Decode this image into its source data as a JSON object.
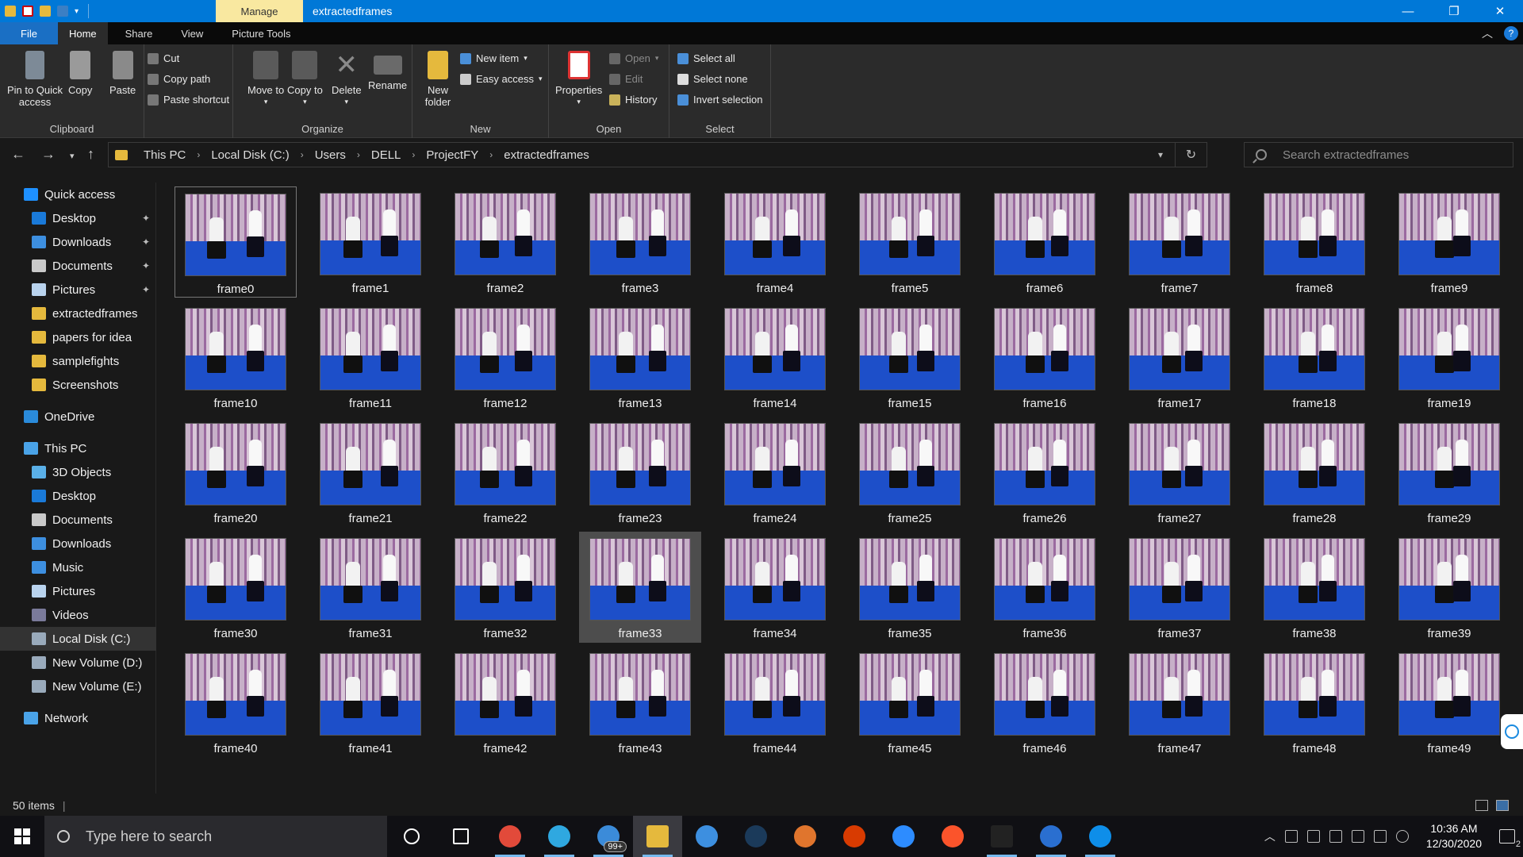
{
  "window": {
    "manage_tab": "Manage",
    "title": "extractedframes",
    "controls": [
      "minimize",
      "restore",
      "close"
    ]
  },
  "ribbon_tabs": [
    "File",
    "Home",
    "Share",
    "View",
    "Picture Tools"
  ],
  "ribbon": {
    "clipboard": {
      "label": "Clipboard",
      "pin": "Pin to Quick access",
      "copy": "Copy",
      "paste": "Paste",
      "cut": "Cut",
      "copy_path": "Copy path",
      "paste_shortcut": "Paste shortcut"
    },
    "organize": {
      "label": "Organize",
      "move_to": "Move to",
      "copy_to": "Copy to",
      "delete": "Delete",
      "rename": "Rename"
    },
    "new": {
      "label": "New",
      "new_folder": "New folder",
      "new_item": "New item",
      "easy_access": "Easy access"
    },
    "open": {
      "label": "Open",
      "properties": "Properties",
      "open": "Open",
      "edit": "Edit",
      "history": "History"
    },
    "select": {
      "label": "Select",
      "select_all": "Select all",
      "select_none": "Select none",
      "invert_selection": "Invert selection"
    }
  },
  "address": {
    "crumbs": [
      "This PC",
      "Local Disk (C:)",
      "Users",
      "DELL",
      "ProjectFY",
      "extractedframes"
    ],
    "search_placeholder": "Search extractedframes"
  },
  "sidebar": {
    "items": [
      {
        "label": "Quick access",
        "icon": "star-icon",
        "color": "#1e90ff",
        "indent": 0,
        "pinned": false
      },
      {
        "label": "Desktop",
        "icon": "desktop-icon",
        "color": "#1a7ad9",
        "indent": 1,
        "pinned": true
      },
      {
        "label": "Downloads",
        "icon": "download-icon",
        "color": "#3d8fe0",
        "indent": 1,
        "pinned": true
      },
      {
        "label": "Documents",
        "icon": "document-icon",
        "color": "#c9c9c9",
        "indent": 1,
        "pinned": true
      },
      {
        "label": "Pictures",
        "icon": "pictures-icon",
        "color": "#b9d3ee",
        "indent": 1,
        "pinned": true
      },
      {
        "label": "extractedframes",
        "icon": "folder-icon",
        "color": "#e5b93d",
        "indent": 1,
        "pinned": false
      },
      {
        "label": "papers for idea",
        "icon": "folder-icon",
        "color": "#e5b93d",
        "indent": 1,
        "pinned": false
      },
      {
        "label": "samplefights",
        "icon": "folder-icon",
        "color": "#e5b93d",
        "indent": 1,
        "pinned": false
      },
      {
        "label": "Screenshots",
        "icon": "folder-icon",
        "color": "#e5b93d",
        "indent": 1,
        "pinned": false
      },
      {
        "label": "OneDrive",
        "icon": "cloud-icon",
        "color": "#2a8bdb",
        "indent": 0,
        "pinned": false
      },
      {
        "label": "This PC",
        "icon": "computer-icon",
        "color": "#4aa3e8",
        "indent": 0,
        "pinned": false
      },
      {
        "label": "3D Objects",
        "icon": "cube-icon",
        "color": "#5ab0e8",
        "indent": 1,
        "pinned": false
      },
      {
        "label": "Desktop",
        "icon": "desktop-icon",
        "color": "#1a7ad9",
        "indent": 1,
        "pinned": false
      },
      {
        "label": "Documents",
        "icon": "document-icon",
        "color": "#c9c9c9",
        "indent": 1,
        "pinned": false
      },
      {
        "label": "Downloads",
        "icon": "download-icon",
        "color": "#3d8fe0",
        "indent": 1,
        "pinned": false
      },
      {
        "label": "Music",
        "icon": "music-icon",
        "color": "#3d8fe0",
        "indent": 1,
        "pinned": false
      },
      {
        "label": "Pictures",
        "icon": "pictures-icon",
        "color": "#b9d3ee",
        "indent": 1,
        "pinned": false
      },
      {
        "label": "Videos",
        "icon": "video-icon",
        "color": "#7a7a9a",
        "indent": 1,
        "pinned": false
      },
      {
        "label": "Local Disk (C:)",
        "icon": "drive-icon",
        "color": "#9ab",
        "indent": 1,
        "pinned": false,
        "active": true
      },
      {
        "label": "New Volume (D:)",
        "icon": "drive-icon",
        "color": "#9ab",
        "indent": 1,
        "pinned": false
      },
      {
        "label": "New Volume (E:)",
        "icon": "drive-icon",
        "color": "#9ab",
        "indent": 1,
        "pinned": false
      },
      {
        "label": "Network",
        "icon": "network-icon",
        "color": "#4aa3e8",
        "indent": 0,
        "pinned": false
      }
    ]
  },
  "files": [
    "frame0",
    "frame1",
    "frame2",
    "frame3",
    "frame4",
    "frame5",
    "frame6",
    "frame7",
    "frame8",
    "frame9",
    "frame10",
    "frame11",
    "frame12",
    "frame13",
    "frame14",
    "frame15",
    "frame16",
    "frame17",
    "frame18",
    "frame19",
    "frame20",
    "frame21",
    "frame22",
    "frame23",
    "frame24",
    "frame25",
    "frame26",
    "frame27",
    "frame28",
    "frame29",
    "frame30",
    "frame31",
    "frame32",
    "frame33",
    "frame34",
    "frame35",
    "frame36",
    "frame37",
    "frame38",
    "frame39",
    "frame40",
    "frame41",
    "frame42",
    "frame43",
    "frame44",
    "frame45",
    "frame46",
    "frame47",
    "frame48",
    "frame49"
  ],
  "focused_file": "frame0",
  "hovered_file": "frame33",
  "status": {
    "item_count": "50 items"
  },
  "taskbar": {
    "search_placeholder": "Type here to search",
    "apps": [
      {
        "name": "cortana-icon",
        "color": "#ffffff"
      },
      {
        "name": "task-view-icon",
        "color": "#ffffff"
      },
      {
        "name": "chrome-icon",
        "color": "#e24a3a"
      },
      {
        "name": "edge-icon",
        "color": "#2fa8e0"
      },
      {
        "name": "mail-icon",
        "color": "#3b8bd9",
        "badge": "99+"
      },
      {
        "name": "file-explorer-icon",
        "color": "#e5b93d",
        "active": true
      },
      {
        "name": "onedrive-upload-icon",
        "color": "#3d8fe0"
      },
      {
        "name": "steam-icon",
        "color": "#1b3a5a"
      },
      {
        "name": "app-orange-icon",
        "color": "#e0752d"
      },
      {
        "name": "office-icon",
        "color": "#d83b01"
      },
      {
        "name": "zoom-icon",
        "color": "#2d8cff"
      },
      {
        "name": "brave-icon",
        "color": "#fb542b"
      },
      {
        "name": "terminal-icon",
        "color": "#222222"
      },
      {
        "name": "app-blue-icon",
        "color": "#2a6fd0"
      },
      {
        "name": "teamviewer-icon",
        "color": "#0e8ee9"
      }
    ],
    "time": "10:36 AM",
    "date": "12/30/2020",
    "notification_count": "2"
  }
}
